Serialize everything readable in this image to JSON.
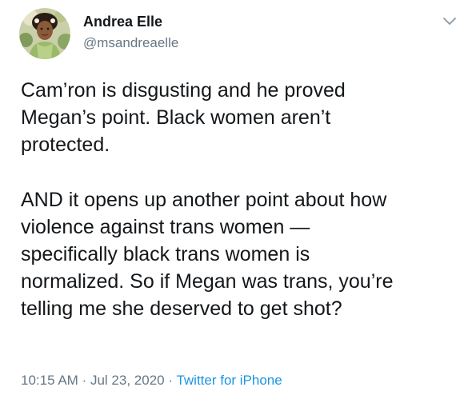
{
  "author": {
    "display_name": "Andrea Elle",
    "handle": "@msandreaelle"
  },
  "tweet": {
    "paragraphs": [
      {
        "lines": [
          "Cam’ron is disgusting and he proved",
          "Megan’s point. Black women aren’t",
          "protected."
        ]
      },
      {
        "lines": [
          "AND it opens up another point about how",
          "violence against trans women —",
          "specifically black trans women is",
          "normalized. So if Megan was trans, you’re",
          "telling me she deserved to get shot?"
        ]
      }
    ]
  },
  "meta": {
    "time": "10:15 AM",
    "separator": "·",
    "date": "Jul 23, 2020",
    "source": "Twitter for iPhone"
  },
  "colors": {
    "text": "#14171a",
    "secondary": "#657786",
    "link": "#1b95e0"
  },
  "icons": {
    "menu": "chevron-down-icon"
  }
}
